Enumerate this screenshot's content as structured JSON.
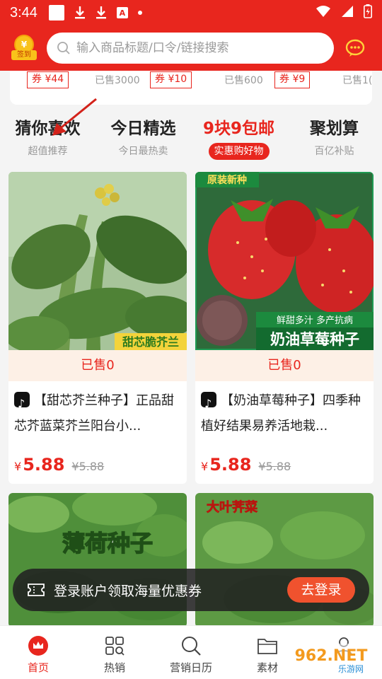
{
  "status": {
    "time": "3:44"
  },
  "header": {
    "avatar_badge": "签到",
    "avatar_coin": "¥",
    "search_placeholder": "输入商品标题/口令/链接搜索"
  },
  "coupons": [
    {
      "tag": "券 ¥44",
      "sold": "已售3000"
    },
    {
      "tag": "券 ¥10",
      "sold": "已售600"
    },
    {
      "tag": "券 ¥9",
      "sold": "已售1("
    }
  ],
  "tabs": [
    {
      "title": "猜你喜欢",
      "sub": "超值推荐"
    },
    {
      "title": "今日精选",
      "sub": "今日最热卖"
    },
    {
      "title": "9块9包邮",
      "sub": "实惠购好物"
    },
    {
      "title": "聚划算",
      "sub": "百亿补贴"
    }
  ],
  "products": [
    {
      "img_label": "甜芯脆芥兰",
      "sold": "已售0",
      "title": "【甜芯芥兰种子】正品甜芯芥蓝菜芥兰阳台小...",
      "yen": "¥",
      "price": "5.88",
      "old_price": "¥5.88"
    },
    {
      "img_label": "奶油草莓种子",
      "img_top_label": "原装新种",
      "img_sub_label": "鲜甜多汁 多产抗病",
      "sold": "已售0",
      "title": "【奶油草莓种子】四季种植好结果易养活地栽...",
      "yen": "¥",
      "price": "5.88",
      "old_price": "¥5.88"
    },
    {
      "img_label": "薄荷种子"
    },
    {
      "img_label": "大叶荠菜"
    }
  ],
  "login_banner": {
    "text": "登录账户领取海量优惠券",
    "button": "去登录"
  },
  "nav": [
    {
      "label": "首页",
      "icon": "crown-icon"
    },
    {
      "label": "热销",
      "icon": "grid-search-icon"
    },
    {
      "label": "营销日历",
      "icon": "search-icon"
    },
    {
      "label": "素材",
      "icon": "folder-icon"
    },
    {
      "label": "",
      "icon": "user-icon"
    }
  ],
  "watermark": {
    "brand": "962.NET",
    "sub": "乐游网"
  },
  "colors": {
    "brand_red": "#e8261e",
    "price_red": "#e8261e",
    "banner_bg": "#222222",
    "login_button": "#f0522e"
  }
}
